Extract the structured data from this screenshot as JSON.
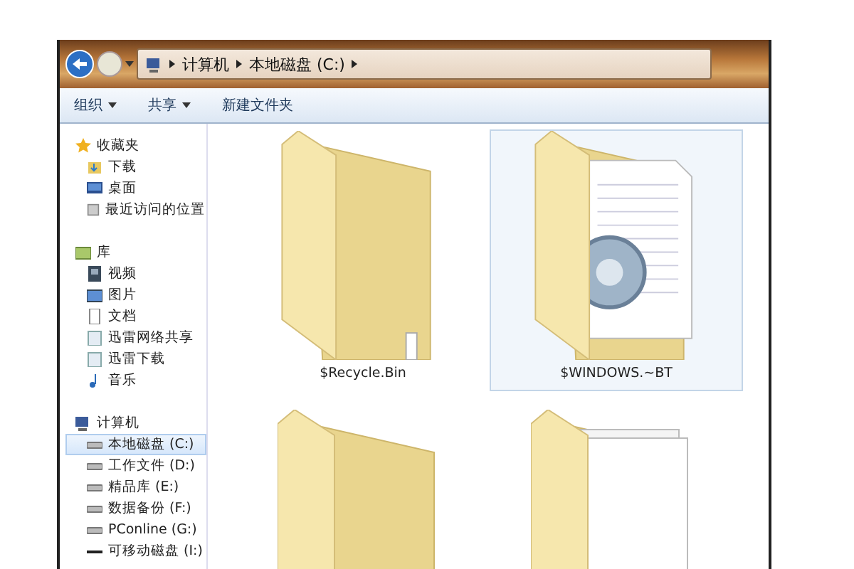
{
  "address_bar": {
    "crumbs": [
      "计算机",
      "本地磁盘 (C:)"
    ]
  },
  "toolbar": [
    {
      "label": "组织",
      "menu": true
    },
    {
      "label": "共享",
      "menu": true
    },
    {
      "label": "新建文件夹",
      "menu": false
    }
  ],
  "sidebar": {
    "groups": [
      {
        "label": "收藏夹",
        "selected": false,
        "children": [
          {
            "label": "下载",
            "selected": false
          },
          {
            "label": "桌面",
            "selected": false
          },
          {
            "label": "最近访问的位置",
            "selected": false
          }
        ]
      },
      {
        "label": "库",
        "selected": false,
        "children": [
          {
            "label": "视频",
            "selected": false
          },
          {
            "label": "图片",
            "selected": false
          },
          {
            "label": "文档",
            "selected": false
          },
          {
            "label": "迅雷网络共享",
            "selected": false
          },
          {
            "label": "迅雷下载",
            "selected": false
          },
          {
            "label": "音乐",
            "selected": false
          }
        ]
      },
      {
        "label": "计算机",
        "selected": false,
        "children": [
          {
            "label": "本地磁盘 (C:)",
            "selected": true
          },
          {
            "label": "工作文件 (D:)",
            "selected": false
          },
          {
            "label": "精品库 (E:)",
            "selected": false
          },
          {
            "label": "数据备份 (F:)",
            "selected": false
          },
          {
            "label": "PConline (G:)",
            "selected": false
          },
          {
            "label": "可移动磁盘 (I:)",
            "selected": false
          }
        ]
      }
    ]
  },
  "folders": [
    {
      "name": "$Recycle.Bin",
      "kind": "plain",
      "selected": false
    },
    {
      "name": "$WINDOWS.~BT",
      "kind": "gear",
      "selected": true
    },
    {
      "kind": "plain",
      "selected": false
    },
    {
      "kind": "documents",
      "selected": false
    }
  ]
}
